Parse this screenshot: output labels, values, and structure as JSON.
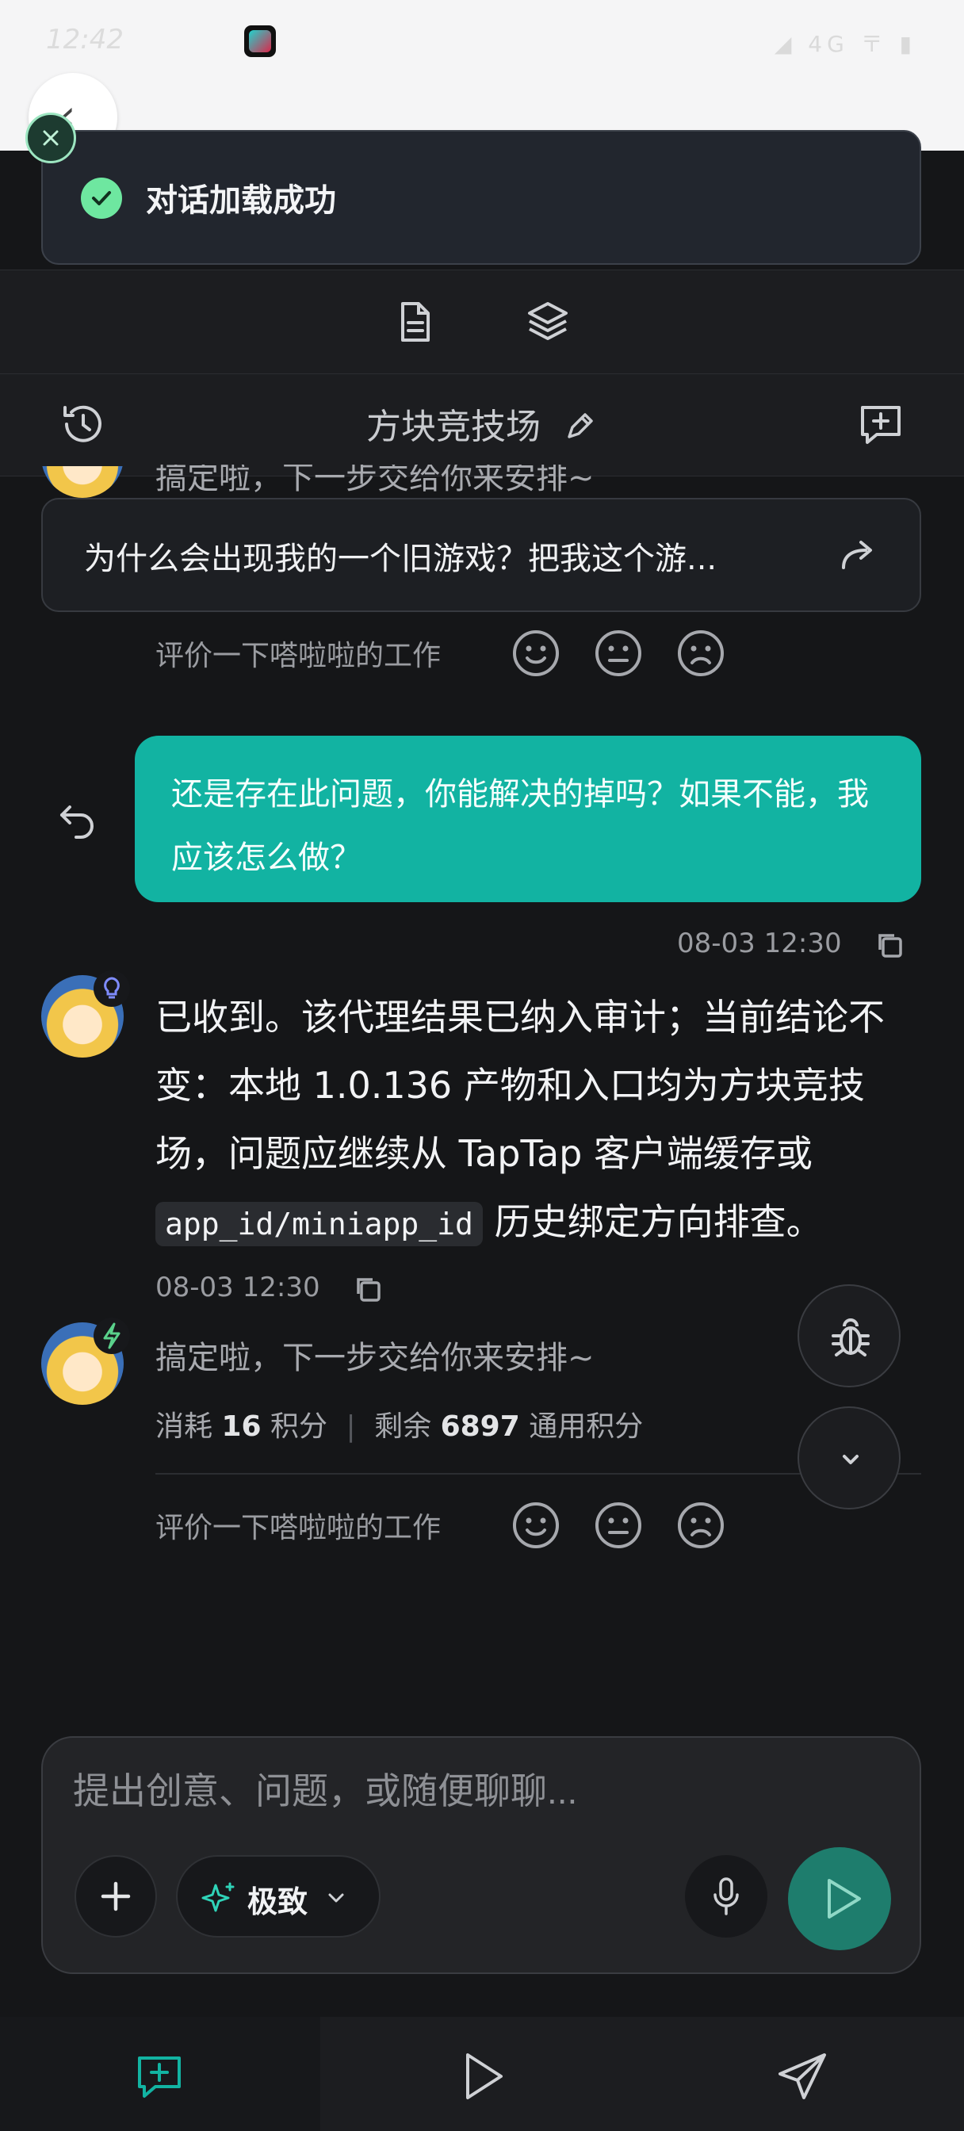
{
  "status_bar": {
    "time": "12:42",
    "icons_right": "◢ 4G 〒 ▮"
  },
  "toast": {
    "message": "对话加载成功"
  },
  "header": {
    "title": "方块竞技场"
  },
  "chat": {
    "clipped_text": "搞定啦，下一步交给你来安排~",
    "pinned_question": "为什么会出现我的一个旧游戏？把我这个游...",
    "rate_label_1": "评价一下嗒啦啦的工作",
    "user_message": "还是存在此问题，你能解决的掉吗？如果不能，我应该怎么做？",
    "user_time": "08-03 12:30",
    "bot_message_part1": "已收到。该代理结果已纳入审计；当前结论不变：本地 1.0.136 产物和入口均为方块竞技场，问题应继续从 TapTap 客户端缓存或",
    "bot_message_code": "app_id/miniapp_id",
    "bot_message_part2": "历史绑定方向排查。",
    "bot_time": "08-03 12:30",
    "done_message": "搞定啦，下一步交给你来安排~",
    "cost_prefix": "消耗",
    "cost_value": "16",
    "cost_unit": "积分",
    "remain_prefix": "剩余",
    "remain_value": "6897",
    "remain_unit": "通用积分",
    "rate_label_2": "评价一下嗒啦啦的工作"
  },
  "composer": {
    "placeholder": "提出创意、问题，或随便聊聊...",
    "mode_label": "极致"
  },
  "colors": {
    "accent": "#12b3a2",
    "send": "#1e7d6d",
    "toast_check": "#6ee7a0"
  }
}
